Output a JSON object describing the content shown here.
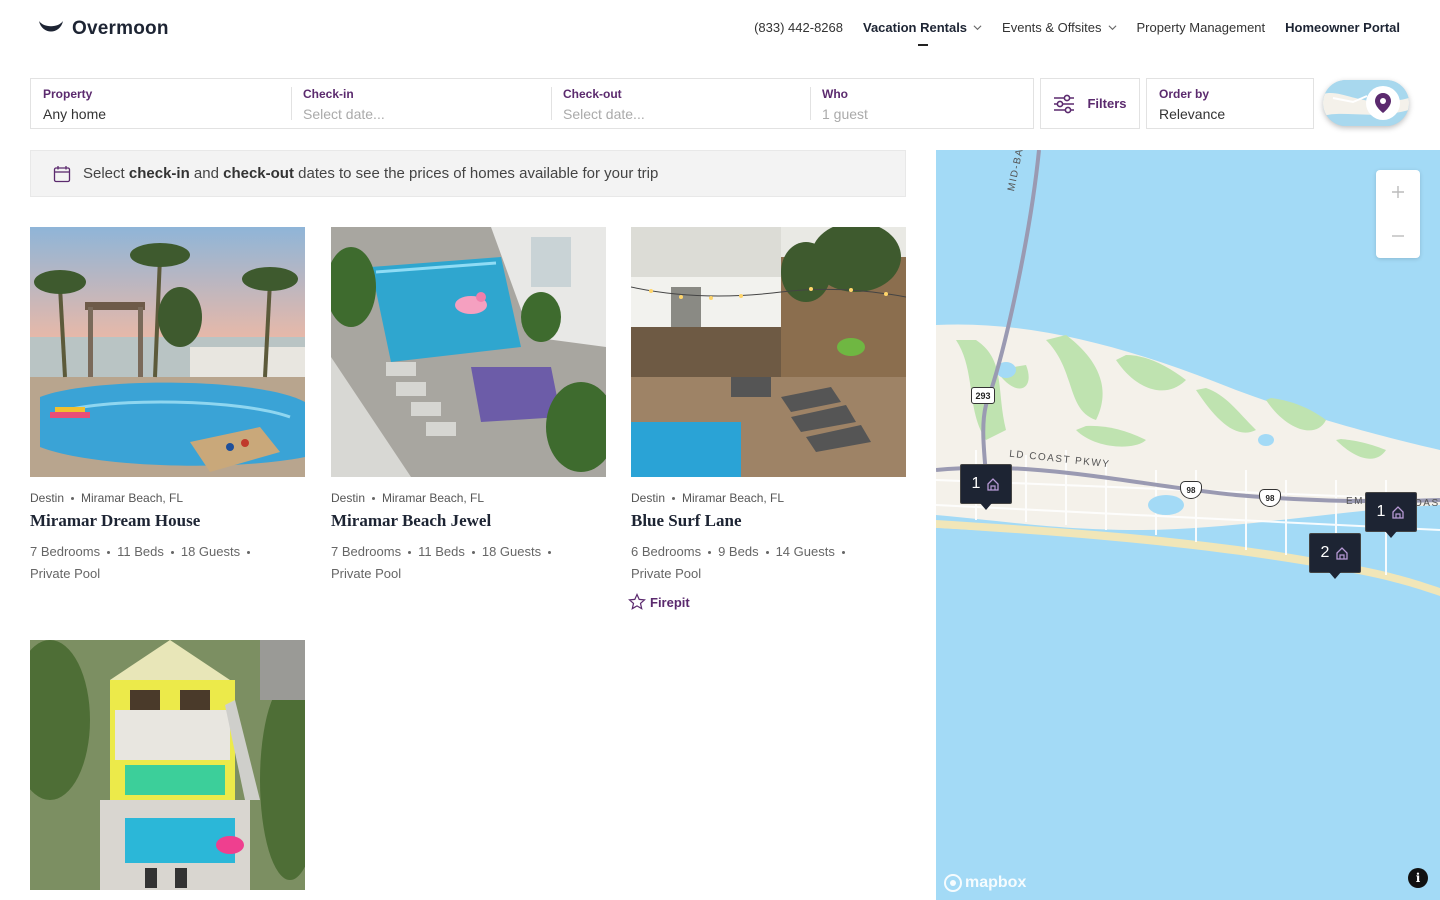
{
  "header": {
    "logo_text": "Overmoon",
    "nav": {
      "phone": "(833) 442-8268",
      "vacation_rentals": "Vacation Rentals",
      "events": "Events & Offsites",
      "property_management": "Property Management",
      "homeowner_portal": "Homeowner Portal"
    }
  },
  "search": {
    "property": {
      "label": "Property",
      "value": "Any home"
    },
    "checkin": {
      "label": "Check-in",
      "placeholder": "Select date..."
    },
    "checkout": {
      "label": "Check-out",
      "placeholder": "Select date..."
    },
    "who": {
      "label": "Who",
      "placeholder": "1 guest"
    },
    "filters_label": "Filters",
    "order_by": {
      "label": "Order by",
      "value": "Relevance"
    }
  },
  "notice": {
    "prefix": "Select",
    "checkin": "check-in",
    "and": "and",
    "checkout": "check-out",
    "suffix": "dates to see the prices of homes available for your trip"
  },
  "listings": [
    {
      "area": "Destin",
      "city": "Miramar Beach, FL",
      "title": "Miramar Dream House",
      "bedrooms": "7 Bedrooms",
      "beds": "11 Beds",
      "guests": "18 Guests",
      "feature": "Private Pool"
    },
    {
      "area": "Destin",
      "city": "Miramar Beach, FL",
      "title": "Miramar Beach Jewel",
      "bedrooms": "7 Bedrooms",
      "beds": "11 Beds",
      "guests": "18 Guests",
      "feature": "Private Pool"
    },
    {
      "area": "Destin",
      "city": "Miramar Beach, FL",
      "title": "Blue Surf Lane",
      "bedrooms": "6 Bedrooms",
      "beds": "9 Beds",
      "guests": "14 Guests",
      "feature": "Private Pool",
      "amenity": "Firepit"
    },
    {
      "area": "",
      "city": "",
      "title": "",
      "bedrooms": "",
      "beds": "",
      "guests": "",
      "feature": ""
    }
  ],
  "map": {
    "markers": [
      {
        "count": "1"
      },
      {
        "count": "1"
      },
      {
        "count": "2"
      }
    ],
    "road_labels": {
      "bridge": "MID-BAY-BRIDG",
      "parkway": "LD COAST PKWY",
      "em": "EM",
      "oas": "OAS"
    },
    "shields": {
      "sr293": "293",
      "us98a": "98",
      "us98b": "98"
    },
    "attribution": "mapbox",
    "info": "i"
  },
  "colors": {
    "brand": "#5b2a6e",
    "navy": "#1d2433",
    "water": "#a3daf6",
    "land": "#f4f1ea",
    "green": "#bfe3b0"
  }
}
